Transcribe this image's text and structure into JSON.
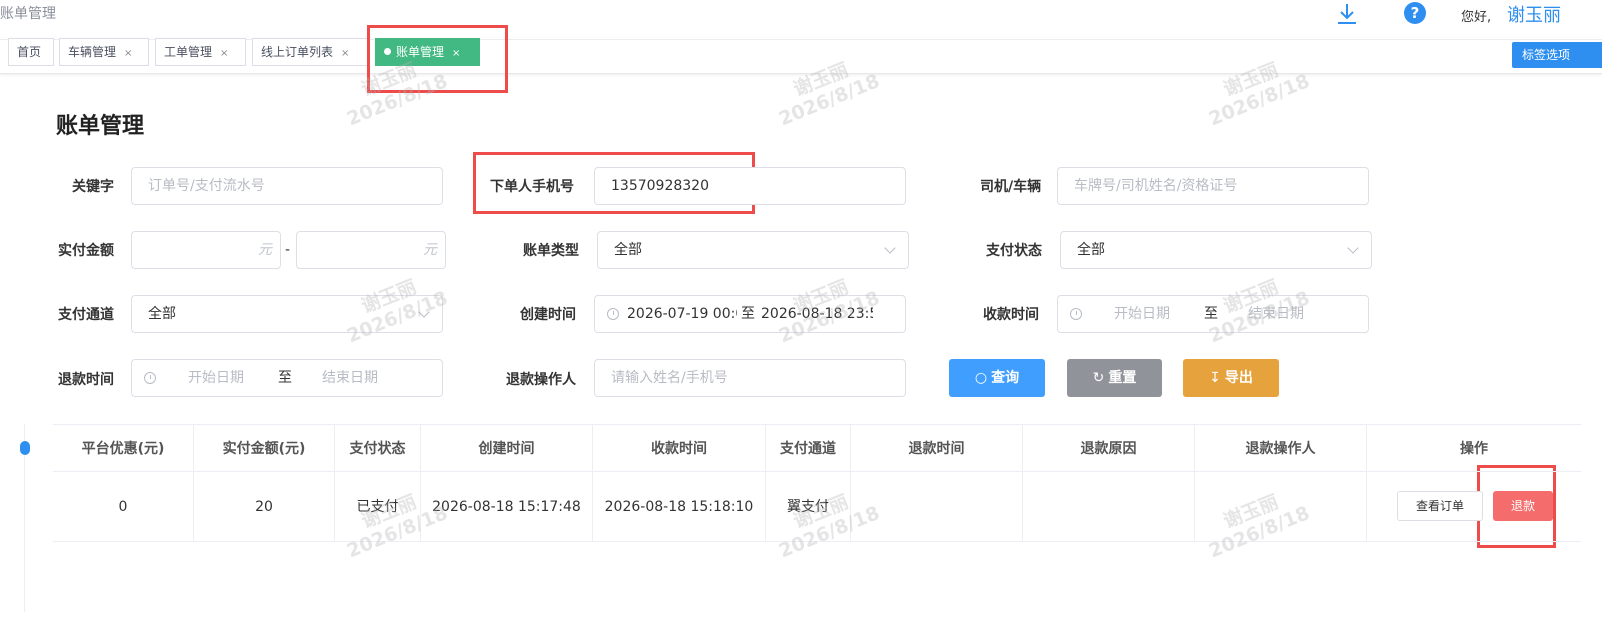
{
  "header": {
    "app_title": "账单管理",
    "greeting": "您好,",
    "username": "谢玉丽"
  },
  "tabs": [
    {
      "label": "首页",
      "closable": false
    },
    {
      "label": "车辆管理",
      "closable": true
    },
    {
      "label": "工单管理",
      "closable": true
    },
    {
      "label": "线上订单列表",
      "closable": true
    },
    {
      "label": "账单管理",
      "closable": true,
      "active": true
    }
  ],
  "tab_close_glyph": "×",
  "tab_options_label": "标签选项",
  "page": {
    "title": "账单管理"
  },
  "form": {
    "keyword": {
      "label": "关键字",
      "placeholder": "订单号/支付流水号"
    },
    "phone": {
      "label": "下单人手机号",
      "value": "13570928320"
    },
    "driver": {
      "label": "司机/车辆",
      "placeholder": "车牌号/司机姓名/资格证号"
    },
    "amount": {
      "label": "实付金额",
      "unit": "元",
      "separator": "-"
    },
    "bill_type": {
      "label": "账单类型",
      "value": "全部"
    },
    "pay_status": {
      "label": "支付状态",
      "value": "全部"
    },
    "pay_channel": {
      "label": "支付通道",
      "value": "全部"
    },
    "created_time": {
      "label": "创建时间",
      "start": "2026-07-19 00:0",
      "separator": "至",
      "end": "2026-08-18 23:5"
    },
    "received_time": {
      "label": "收款时间",
      "start_placeholder": "开始日期",
      "separator": "至",
      "end_placeholder": "结束日期"
    },
    "refund_time": {
      "label": "退款时间",
      "start_placeholder": "开始日期",
      "separator": "至",
      "end_placeholder": "结束日期"
    },
    "refund_operator": {
      "label": "退款操作人",
      "placeholder": "请输入姓名/手机号"
    }
  },
  "buttons": {
    "search": {
      "label": "查询",
      "color": "#409eff"
    },
    "reset": {
      "label": "重置",
      "color": "#909399"
    },
    "export": {
      "label": "导出",
      "color": "#e6a23c"
    }
  },
  "table": {
    "columns": [
      "平台优惠(元)",
      "实付金额(元)",
      "支付状态",
      "创建时间",
      "收款时间",
      "支付通道",
      "退款时间",
      "退款原因",
      "退款操作人",
      "操作"
    ],
    "rows": [
      [
        "0",
        "20",
        "已支付",
        "2026-08-18 15:17:48",
        "2026-08-18 15:18:10",
        "翼支付",
        "",
        "",
        ""
      ]
    ],
    "actions": {
      "view": "查看订单",
      "refund": "退款"
    }
  },
  "watermark": {
    "name": "谢玉丽",
    "date": "2026/8/18"
  },
  "colors": {
    "accent": "#2f8ff0",
    "active_tab": "#42b983",
    "highlight": "#ee4b4b",
    "danger": "#f56c6c"
  }
}
